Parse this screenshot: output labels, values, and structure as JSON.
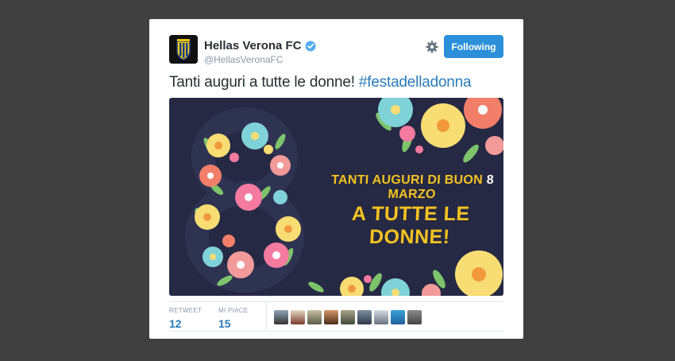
{
  "tweet": {
    "display_name": "Hellas Verona FC",
    "handle": "@HellasVeronaFC",
    "follow_label": "Following",
    "text_plain": "Tanti auguri a tutte le donne! ",
    "hashtag": "#festadelladonna"
  },
  "media": {
    "line1_pre": "TANTI AUGURI DI BUON ",
    "line1_num": "8",
    "line1_post": " MARZO",
    "line2": "A TUTTE LE DONNE!"
  },
  "stats": {
    "retweet_label": "RETWEET",
    "retweet_count": "12",
    "like_label": "MI PIACE",
    "like_count": "15"
  },
  "likers": [
    "avatar-1",
    "avatar-2",
    "avatar-3",
    "avatar-4",
    "avatar-5",
    "avatar-6",
    "avatar-7",
    "avatar-8",
    "avatar-9"
  ],
  "colors": {
    "follow_button": "#2b90d9",
    "hashtag": "#2b7bb9",
    "media_bg": "#262944",
    "promo_text": "#f4c21f"
  }
}
